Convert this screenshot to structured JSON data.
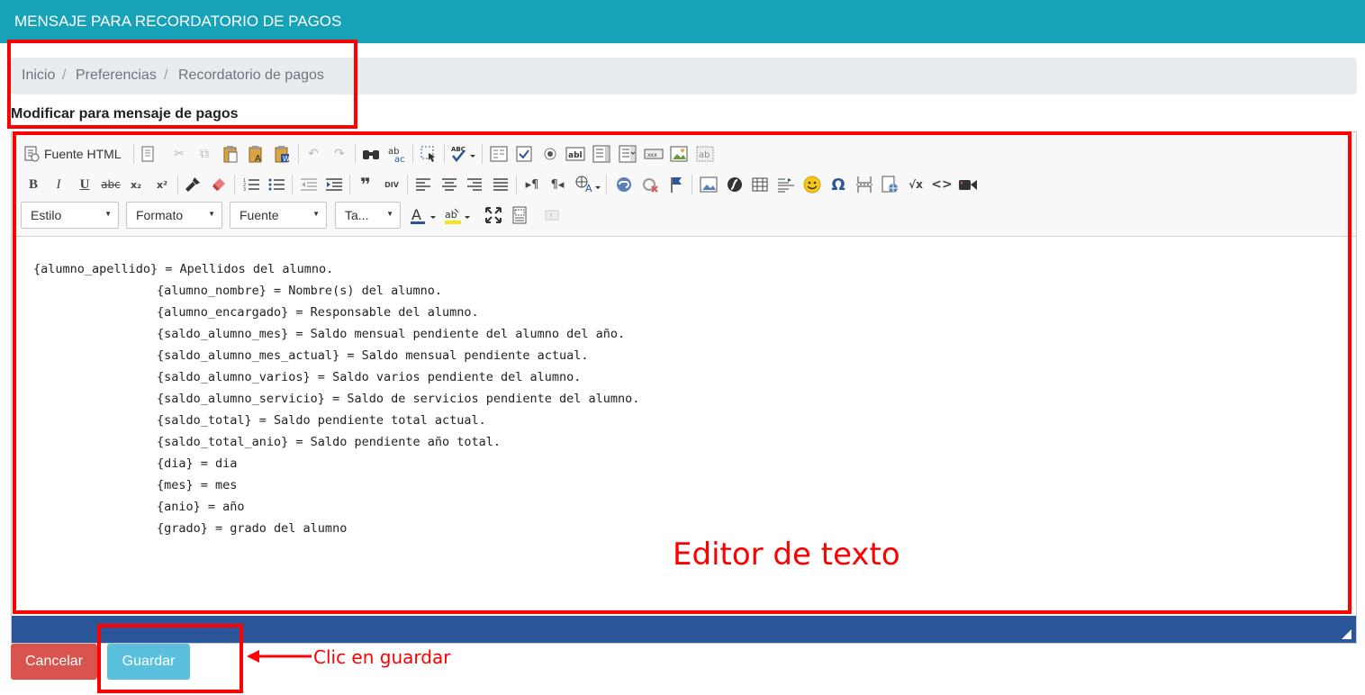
{
  "header": {
    "title": "MENSAJE PARA RECORDATORIO DE PAGOS"
  },
  "breadcrumb": {
    "separator": "/",
    "items": [
      "Inicio",
      "Preferencias",
      "Recordatorio de pagos"
    ]
  },
  "form": {
    "label": "Modificar para mensaje de pagos"
  },
  "editor": {
    "source_button": "Fuente HTML",
    "combos": {
      "style": "Estilo",
      "format": "Formato",
      "font": "Fuente",
      "size": "Ta..."
    },
    "icons": {
      "row1": [
        "source-icon",
        "templates-icon",
        "cut-icon",
        "copy-icon",
        "paste-icon",
        "paste-text-icon",
        "paste-word-icon",
        "undo-icon",
        "redo-icon",
        "find-icon",
        "replace-icon",
        "select-all-icon",
        "spellcheck-icon",
        "form-icon",
        "checkbox-icon",
        "radio-icon",
        "textfield-icon",
        "textarea-icon",
        "select-field-icon",
        "button-field-icon",
        "image-button-icon",
        "hidden-field-icon"
      ],
      "row2": [
        "bold-icon",
        "italic-icon",
        "underline-icon",
        "strike-icon",
        "subscript-icon",
        "superscript-icon",
        "copy-format-icon",
        "remove-format-icon",
        "numbered-list-icon",
        "bulleted-list-icon",
        "outdent-icon",
        "indent-icon",
        "blockquote-icon",
        "div-icon",
        "align-left-icon",
        "align-center-icon",
        "align-right-icon",
        "justify-icon",
        "ltr-icon",
        "rtl-icon",
        "language-icon",
        "link-icon",
        "unlink-icon",
        "anchor-icon",
        "image-icon",
        "flash-icon",
        "table-icon",
        "horizontal-rule-icon",
        "smiley-icon",
        "special-char-icon",
        "page-break-icon",
        "iframe-icon",
        "math-icon",
        "code-snippet-icon",
        "video-icon"
      ],
      "row3": [
        "text-color-icon",
        "background-color-icon",
        "maximize-icon",
        "show-blocks-icon",
        "about-icon"
      ]
    },
    "glyphs": {
      "bold": "B",
      "italic": "I",
      "underline": "U",
      "strike": "abc",
      "subscript": "x₂",
      "superscript": "x²",
      "blockquote": "❞",
      "div": "DIV",
      "omega": "Ω",
      "spell": "ABC",
      "abl": "abl",
      "ab": "ab",
      "xxx": "xxx",
      "math": "√x",
      "code": "<>",
      "text_color": "A",
      "bg_color": "ab"
    },
    "content_lines": [
      "{alumno_apellido} = Apellidos del alumno.",
      "{alumno_nombre} = Nombre(s) del alumno.",
      "{alumno_encargado} = Responsable del alumno.",
      "{saldo_alumno_mes} = Saldo mensual pendiente del alumno del año.",
      "{saldo_alumno_mes_actual} = Saldo mensual pendiente actual.",
      "{saldo_alumno_varios} = Saldo varios pendiente del alumno.",
      "{saldo_alumno_servicio} = Saldo de servicios pendiente del alumno.",
      "{saldo_total} = Saldo pendiente total actual.",
      "{saldo_total_anio} = Saldo pendiente año total.",
      "{dia} = dia",
      "{mes} = mes",
      "{anio} = año",
      "{grado} = grado del alumno"
    ]
  },
  "actions": {
    "cancel": "Cancelar",
    "save": "Guardar"
  },
  "annotations": {
    "editor_label": "Editor de texto",
    "save_hint": "Clic en guardar",
    "color": "#ff0000"
  },
  "colors": {
    "topbar": "#17a2b8",
    "statusbar": "#2b579a",
    "cancel": "#d9534f",
    "save": "#5bc0de"
  }
}
